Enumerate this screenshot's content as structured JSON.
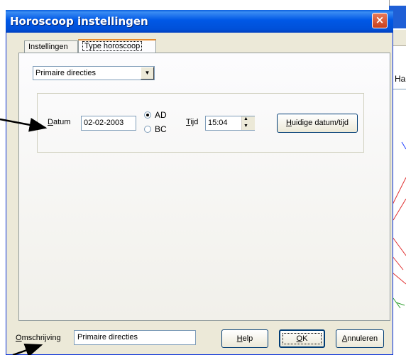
{
  "dialog": {
    "title": "Horoscoop instellingen",
    "close_glyph": "×"
  },
  "tabs": [
    {
      "label": "Instellingen",
      "active": false
    },
    {
      "label": "Type horoscoop",
      "active": true
    }
  ],
  "combo": {
    "value": "Primaire directies"
  },
  "datum": {
    "label_underline": "D",
    "label_rest": "atum",
    "value": "02-02-2003"
  },
  "era": {
    "ad": "AD",
    "bc": "BC",
    "selected": "AD"
  },
  "tijd": {
    "label_underline": "T",
    "label_rest": "ijd",
    "value": "15:04"
  },
  "huidige_button": {
    "underline": "H",
    "rest": "uidige datum/tijd"
  },
  "omschrijving": {
    "label_underline": "O",
    "label_rest": "mschrijving",
    "value": "Primaire directies"
  },
  "buttons": {
    "help": {
      "underline": "H",
      "rest": "elp"
    },
    "ok": {
      "underline": "O",
      "rest": "K"
    },
    "annuleren": {
      "underline": "A",
      "rest": "nnuleren"
    }
  },
  "background_window": {
    "label": "Ha"
  }
}
